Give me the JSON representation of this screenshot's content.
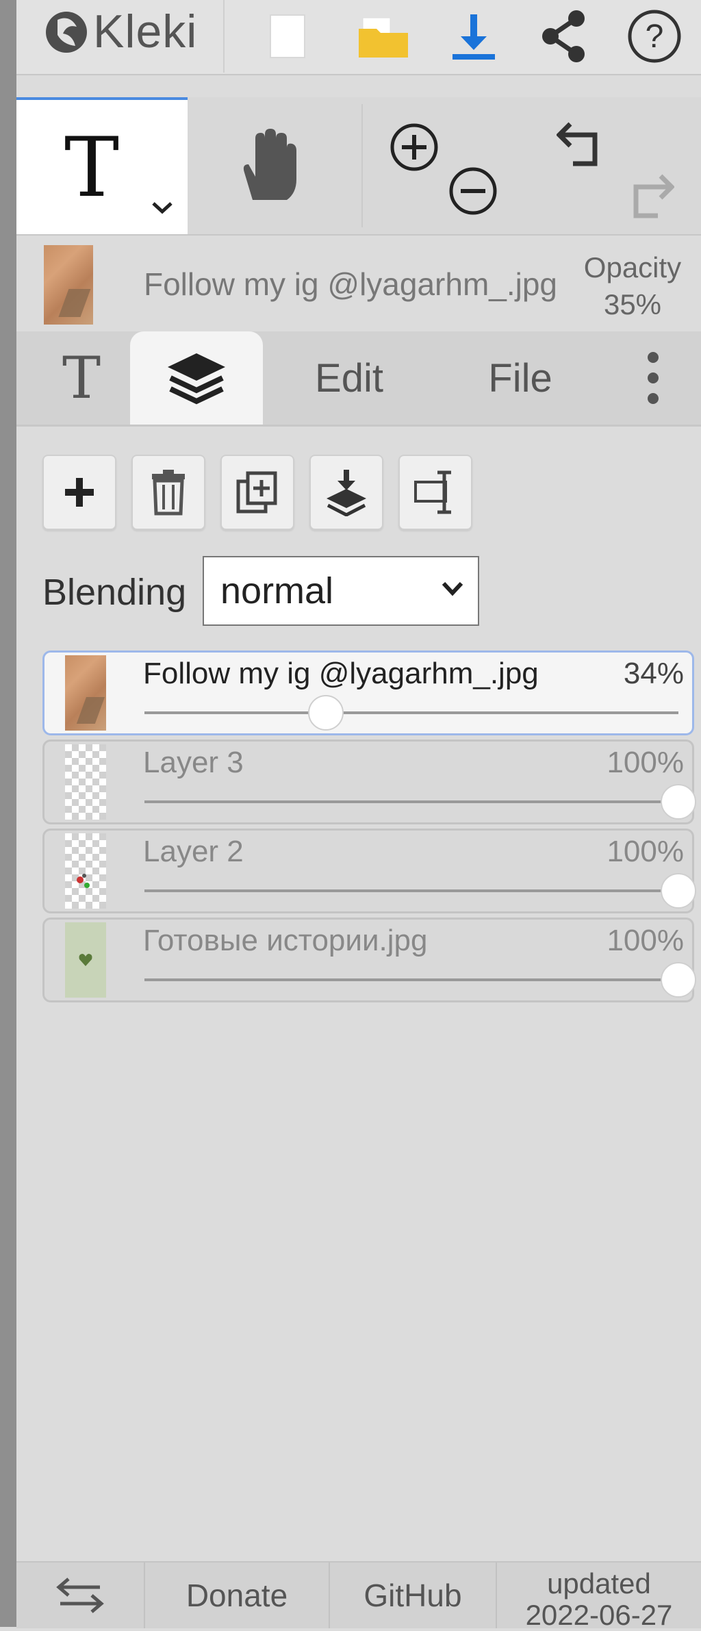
{
  "app": {
    "name": "Kleki"
  },
  "layer_info": {
    "name": "Follow my ig @lyagarhm_.jpg",
    "opacity_label": "Opacity",
    "opacity_value": "35%"
  },
  "tabs": {
    "edit": "Edit",
    "file": "File"
  },
  "blending": {
    "label": "Blending",
    "value": "normal"
  },
  "layers": [
    {
      "name": "Follow my ig @lyagarhm_.jpg",
      "opacity": "34%",
      "level": 0.34,
      "selected": true
    },
    {
      "name": "Layer 3",
      "opacity": "100%",
      "level": 1.0
    },
    {
      "name": "Layer 2",
      "opacity": "100%",
      "level": 1.0
    },
    {
      "name": "Готовые истории.jpg",
      "opacity": "100%",
      "level": 1.0
    }
  ],
  "footer": {
    "donate": "Donate",
    "github": "GitHub",
    "updated_line1": "updated",
    "updated_line2": "2022-06-27"
  },
  "colors": {
    "accent": "#4a8ae0",
    "download": "#1a73d9",
    "folder": "#f2c230"
  },
  "icons": {
    "topbar": [
      "kleki-logo-icon",
      "new-file-icon",
      "open-folder-icon",
      "download-icon",
      "share-icon",
      "help-icon"
    ],
    "tools": [
      "text-tool-icon",
      "hand-tool-icon",
      "zoom-in-icon",
      "zoom-out-icon",
      "undo-icon",
      "redo-icon"
    ],
    "layer_actions": [
      "add-layer-icon",
      "delete-layer-icon",
      "duplicate-layer-icon",
      "merge-down-icon",
      "rename-layer-icon"
    ]
  }
}
